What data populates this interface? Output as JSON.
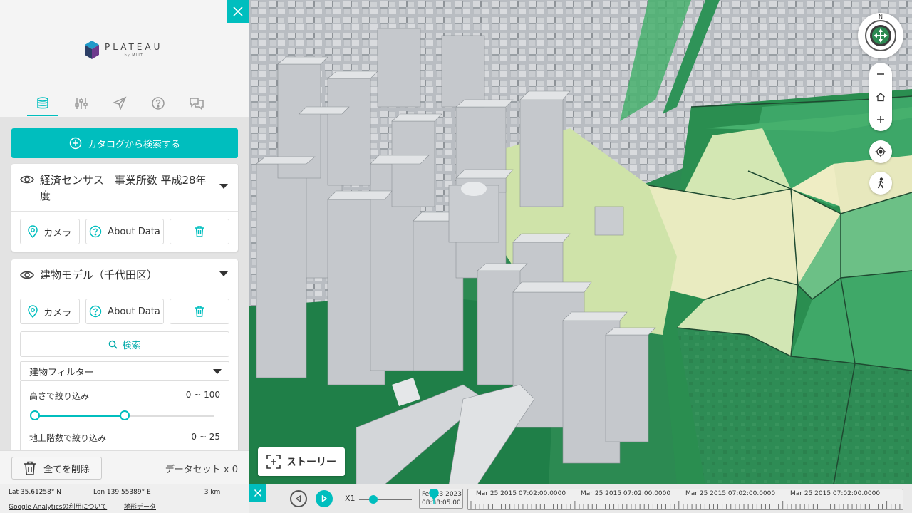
{
  "logo": {
    "main": "PLATEAU",
    "sub": "by MLIT"
  },
  "tabs": [
    {
      "name": "data",
      "icon": "database-icon",
      "active": true
    },
    {
      "name": "map-settings",
      "icon": "sliders-icon",
      "active": false
    },
    {
      "name": "share",
      "icon": "send-icon",
      "active": false
    },
    {
      "name": "help",
      "icon": "help-icon",
      "active": false
    },
    {
      "name": "feedback",
      "icon": "chat-icon",
      "active": false
    }
  ],
  "catalog_button": "カタログから検索する",
  "datasets": [
    {
      "title": "経済センサス　事業所数 平成28年度",
      "actions": {
        "camera": "カメラ",
        "about": "About Data"
      }
    },
    {
      "title": "建物モデル（千代田区）",
      "actions": {
        "camera": "カメラ",
        "about": "About Data"
      },
      "search_label": "検索",
      "filter": {
        "select_value": "建物フィルター",
        "height": {
          "label": "高さで絞り込み",
          "range": "0 ~ 100",
          "min_frac": 0.0,
          "max_frac": 0.5
        },
        "floors": {
          "label": "地上階数で絞り込み",
          "range": "0 ~ 25"
        }
      }
    }
  ],
  "footer": {
    "delete_all": "全てを削除",
    "dataset_count": "データセット x 0"
  },
  "status": {
    "lat": "Lat  35.61258° N",
    "lon": "Lon  139.55389° E",
    "scale": "3 km",
    "analytics_link": "Google Analyticsの利用について",
    "terrain_link": "地形データ"
  },
  "map": {
    "compass_north": "N",
    "story_button": "ストーリー"
  },
  "timeline": {
    "speed": "X1",
    "current_date": "Feb 23 2023",
    "current_time": "08:38:05.00",
    "labels": [
      "Mar 25 2015 07:02:00.0000",
      "Mar 25 2015 07:02:00.0000",
      "Mar 25 2015 07:02:00.0000",
      "Mar 25 2015 07:02:00.0000"
    ]
  },
  "colors": {
    "accent": "#00bebe",
    "zone_dark": "#218a4e",
    "zone_mid": "#47b06c",
    "zone_light": "#d4e8b4",
    "zone_cream": "#efedc4",
    "building": "#c8cbcf"
  }
}
